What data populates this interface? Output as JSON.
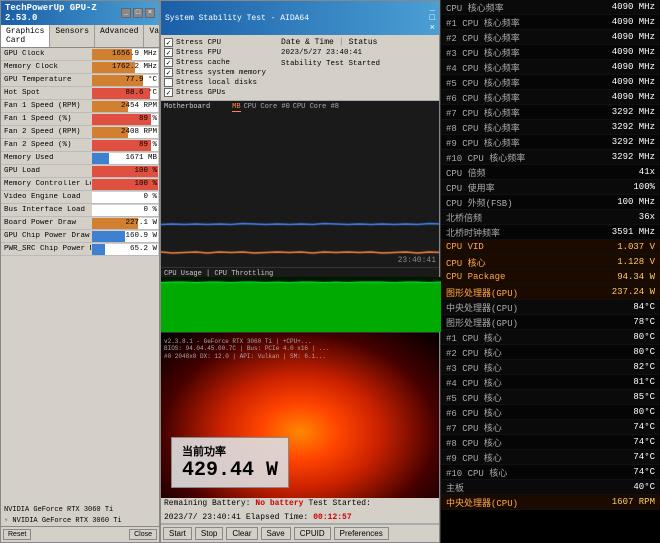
{
  "left": {
    "title": "TechPowerUp GPU-Z 2.53.0",
    "tabs": [
      "Graphics Card",
      "Sensors",
      "Advanced",
      "Validation"
    ],
    "rows": [
      {
        "label": "GPU Clock",
        "value": "1656.9 MHz",
        "pct": 60
      },
      {
        "label": "Memory Clock",
        "value": "1762.2 MHz",
        "pct": 65
      },
      {
        "label": "GPU Temperature",
        "value": "77.9 °C",
        "pct": 78
      },
      {
        "label": "Hot Spot",
        "value": "88.6 °C",
        "pct": 88
      },
      {
        "label": "Fan 1 Speed (RPM)",
        "value": "2454 RPM",
        "pct": 55
      },
      {
        "label": "Fan 1 Speed (%)",
        "value": "89 %",
        "pct": 89
      },
      {
        "label": "Fan 2 Speed (RPM)",
        "value": "2408 RPM",
        "pct": 54
      },
      {
        "label": "Fan 2 Speed (%)",
        "value": "89 %",
        "pct": 89
      },
      {
        "label": "Memory Used",
        "value": "1671 MB",
        "pct": 25
      },
      {
        "label": "GPU Load",
        "value": "100 %",
        "pct": 100
      },
      {
        "label": "Memory Controller Load",
        "value": "100 %",
        "pct": 100
      },
      {
        "label": "Video Engine Load",
        "value": "0 %",
        "pct": 0
      },
      {
        "label": "Bus Interface Load",
        "value": "0 %",
        "pct": 0
      },
      {
        "label": "Board Power Draw",
        "value": "227.1 W",
        "pct": 70
      },
      {
        "label": "GPU Chip Power Draw",
        "value": "160.9 W",
        "pct": 50
      },
      {
        "label": "PWR_SRC Chip Power Draw",
        "value": "65.2 W",
        "pct": 20
      }
    ],
    "card_name": "NVIDIA GeForce RTX 3060 Ti",
    "reset_btn": "Reset",
    "close_btn": "Close"
  },
  "middle": {
    "title": "System Stability Test - AIDA64",
    "stress_tests": [
      {
        "label": "Stress CPU",
        "checked": true
      },
      {
        "label": "Stress FPU",
        "checked": true
      },
      {
        "label": "Stress cache",
        "checked": true
      },
      {
        "label": "Stress system memory",
        "checked": true
      },
      {
        "label": "Stress local disks",
        "checked": false
      },
      {
        "label": "Stress GPUs",
        "checked": true
      }
    ],
    "date_time": "2023/5/27 23:40:41",
    "status": "Stability Test Started",
    "graph1_label": "Motherboard",
    "graph2_label": "CPU Usage | CPU Throttling",
    "time_display": "23:40:41",
    "remaining_battery": "No battery",
    "test_started": "2023/7/ 23:40:41",
    "elapsed_time": "00:12:57",
    "buttons": [
      "Start",
      "Stop",
      "Clear",
      "Save",
      "CPUID",
      "Preferences"
    ],
    "power_label": "当前功率",
    "power_value": "429.44 W"
  },
  "right": {
    "cpu_rows": [
      {
        "label": "CPU 核心频率",
        "value": "4090 MHz",
        "type": "normal"
      },
      {
        "label": "#1 CPU 核心频率",
        "value": "4090 MHz",
        "type": "normal"
      },
      {
        "label": "#2 CPU 核心频率",
        "value": "4090 MHz",
        "type": "normal"
      },
      {
        "label": "#3 CPU 核心频率",
        "value": "4090 MHz",
        "type": "normal"
      },
      {
        "label": "#4 CPU 核心频率",
        "value": "4090 MHz",
        "type": "normal"
      },
      {
        "label": "#5 CPU 核心频率",
        "value": "4090 MHz",
        "type": "normal"
      },
      {
        "label": "#6 CPU 核心频率",
        "value": "4090 MHz",
        "type": "normal"
      },
      {
        "label": "#7 CPU 核心频率",
        "value": "3292 MHz",
        "type": "normal"
      },
      {
        "label": "#8 CPU 核心频率",
        "value": "3292 MHz",
        "type": "normal"
      },
      {
        "label": "#9 CPU 核心频率",
        "value": "3292 MHz",
        "type": "normal"
      },
      {
        "label": "#10 CPU 核心频率",
        "value": "3292 MHz",
        "type": "normal"
      },
      {
        "label": "CPU 倍频",
        "value": "41x",
        "type": "normal"
      },
      {
        "label": "CPU 使用率",
        "value": "100%",
        "type": "normal"
      },
      {
        "label": "CPU 外频(FSB)",
        "value": "100 MHz",
        "type": "normal"
      },
      {
        "label": "北桥倍频",
        "value": "36x",
        "type": "normal"
      },
      {
        "label": "北桥时钟频率",
        "value": "3591 MHz",
        "type": "normal"
      },
      {
        "label": "CPU VID",
        "value": "1.037 V",
        "type": "highlight"
      },
      {
        "label": "CPU 核心",
        "value": "1.128 V",
        "type": "highlight"
      },
      {
        "label": "CPU Package",
        "value": "94.34 W",
        "type": "highlight"
      },
      {
        "label": "图形处理器(GPU)",
        "value": "237.24 W",
        "type": "highlight"
      },
      {
        "label": "中央处理器(CPU)",
        "value": "84°C",
        "type": "normal"
      },
      {
        "label": "图形处理器(GPU)",
        "value": "78°C",
        "type": "normal"
      },
      {
        "label": "#1 CPU 核心",
        "value": "80°C",
        "type": "normal"
      },
      {
        "label": "#2 CPU 核心",
        "value": "80°C",
        "type": "normal"
      },
      {
        "label": "#3 CPU 核心",
        "value": "82°C",
        "type": "normal"
      },
      {
        "label": "#4 CPU 核心",
        "value": "81°C",
        "type": "normal"
      },
      {
        "label": "#5 CPU 核心",
        "value": "85°C",
        "type": "normal"
      },
      {
        "label": "#6 CPU 核心",
        "value": "80°C",
        "type": "normal"
      },
      {
        "label": "#7 CPU 核心",
        "value": "74°C",
        "type": "normal"
      },
      {
        "label": "#8 CPU 核心",
        "value": "74°C",
        "type": "normal"
      },
      {
        "label": "#9 CPU 核心",
        "value": "74°C",
        "type": "normal"
      },
      {
        "label": "#10 CPU 核心",
        "value": "74°C",
        "type": "normal"
      },
      {
        "label": "主板",
        "value": "40°C",
        "type": "normal"
      },
      {
        "label": "中央处理器(CPU)",
        "value": "1607 RPM",
        "type": "highlight"
      }
    ]
  }
}
